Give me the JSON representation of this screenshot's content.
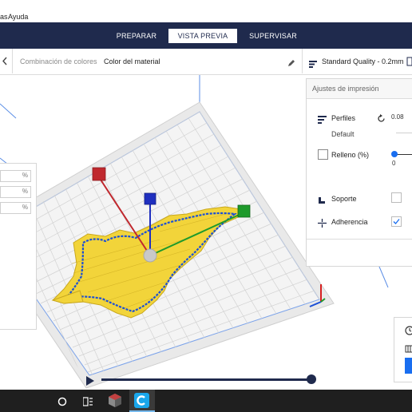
{
  "menu": {
    "item_partial": "as",
    "help": "Ayuda"
  },
  "stages": [
    {
      "label": "PREPARAR",
      "active": false
    },
    {
      "label": "VISTA PREVIA",
      "active": true
    },
    {
      "label": "SUPERVISAR",
      "active": false
    }
  ],
  "header": {
    "color_scheme_label": "Combinación de colores",
    "color_scheme_value": "Color del material",
    "quality": "Standard Quality - 0.2mm"
  },
  "left_panel": {
    "units": [
      "%",
      "%",
      "%"
    ]
  },
  "print_settings": {
    "title": "Ajustes de impresión",
    "profiles_label": "Perfiles",
    "profile_value": "Default",
    "layer_value": "0.08",
    "infill_label": "Relleno (%)",
    "infill_value": "0",
    "support_label": "Soporte",
    "adhesion_label": "Adherencia",
    "support_checked": false,
    "adhesion_checked": true
  },
  "layer_slider": {
    "position": 1.0
  },
  "colors": {
    "stage_bar": "#1f2a4d",
    "accent": "#196ef0",
    "model_yellow": "#f2d43a",
    "model_blue": "#1a4fd6"
  },
  "icons": [
    "back-chevron-icon",
    "edit-pencil-icon",
    "quality-icon",
    "profiles-icon",
    "reset-icon",
    "support-icon",
    "adhesion-icon",
    "play-icon",
    "clock-icon",
    "task-view-icon",
    "search-circle-icon",
    "cura-icon"
  ]
}
